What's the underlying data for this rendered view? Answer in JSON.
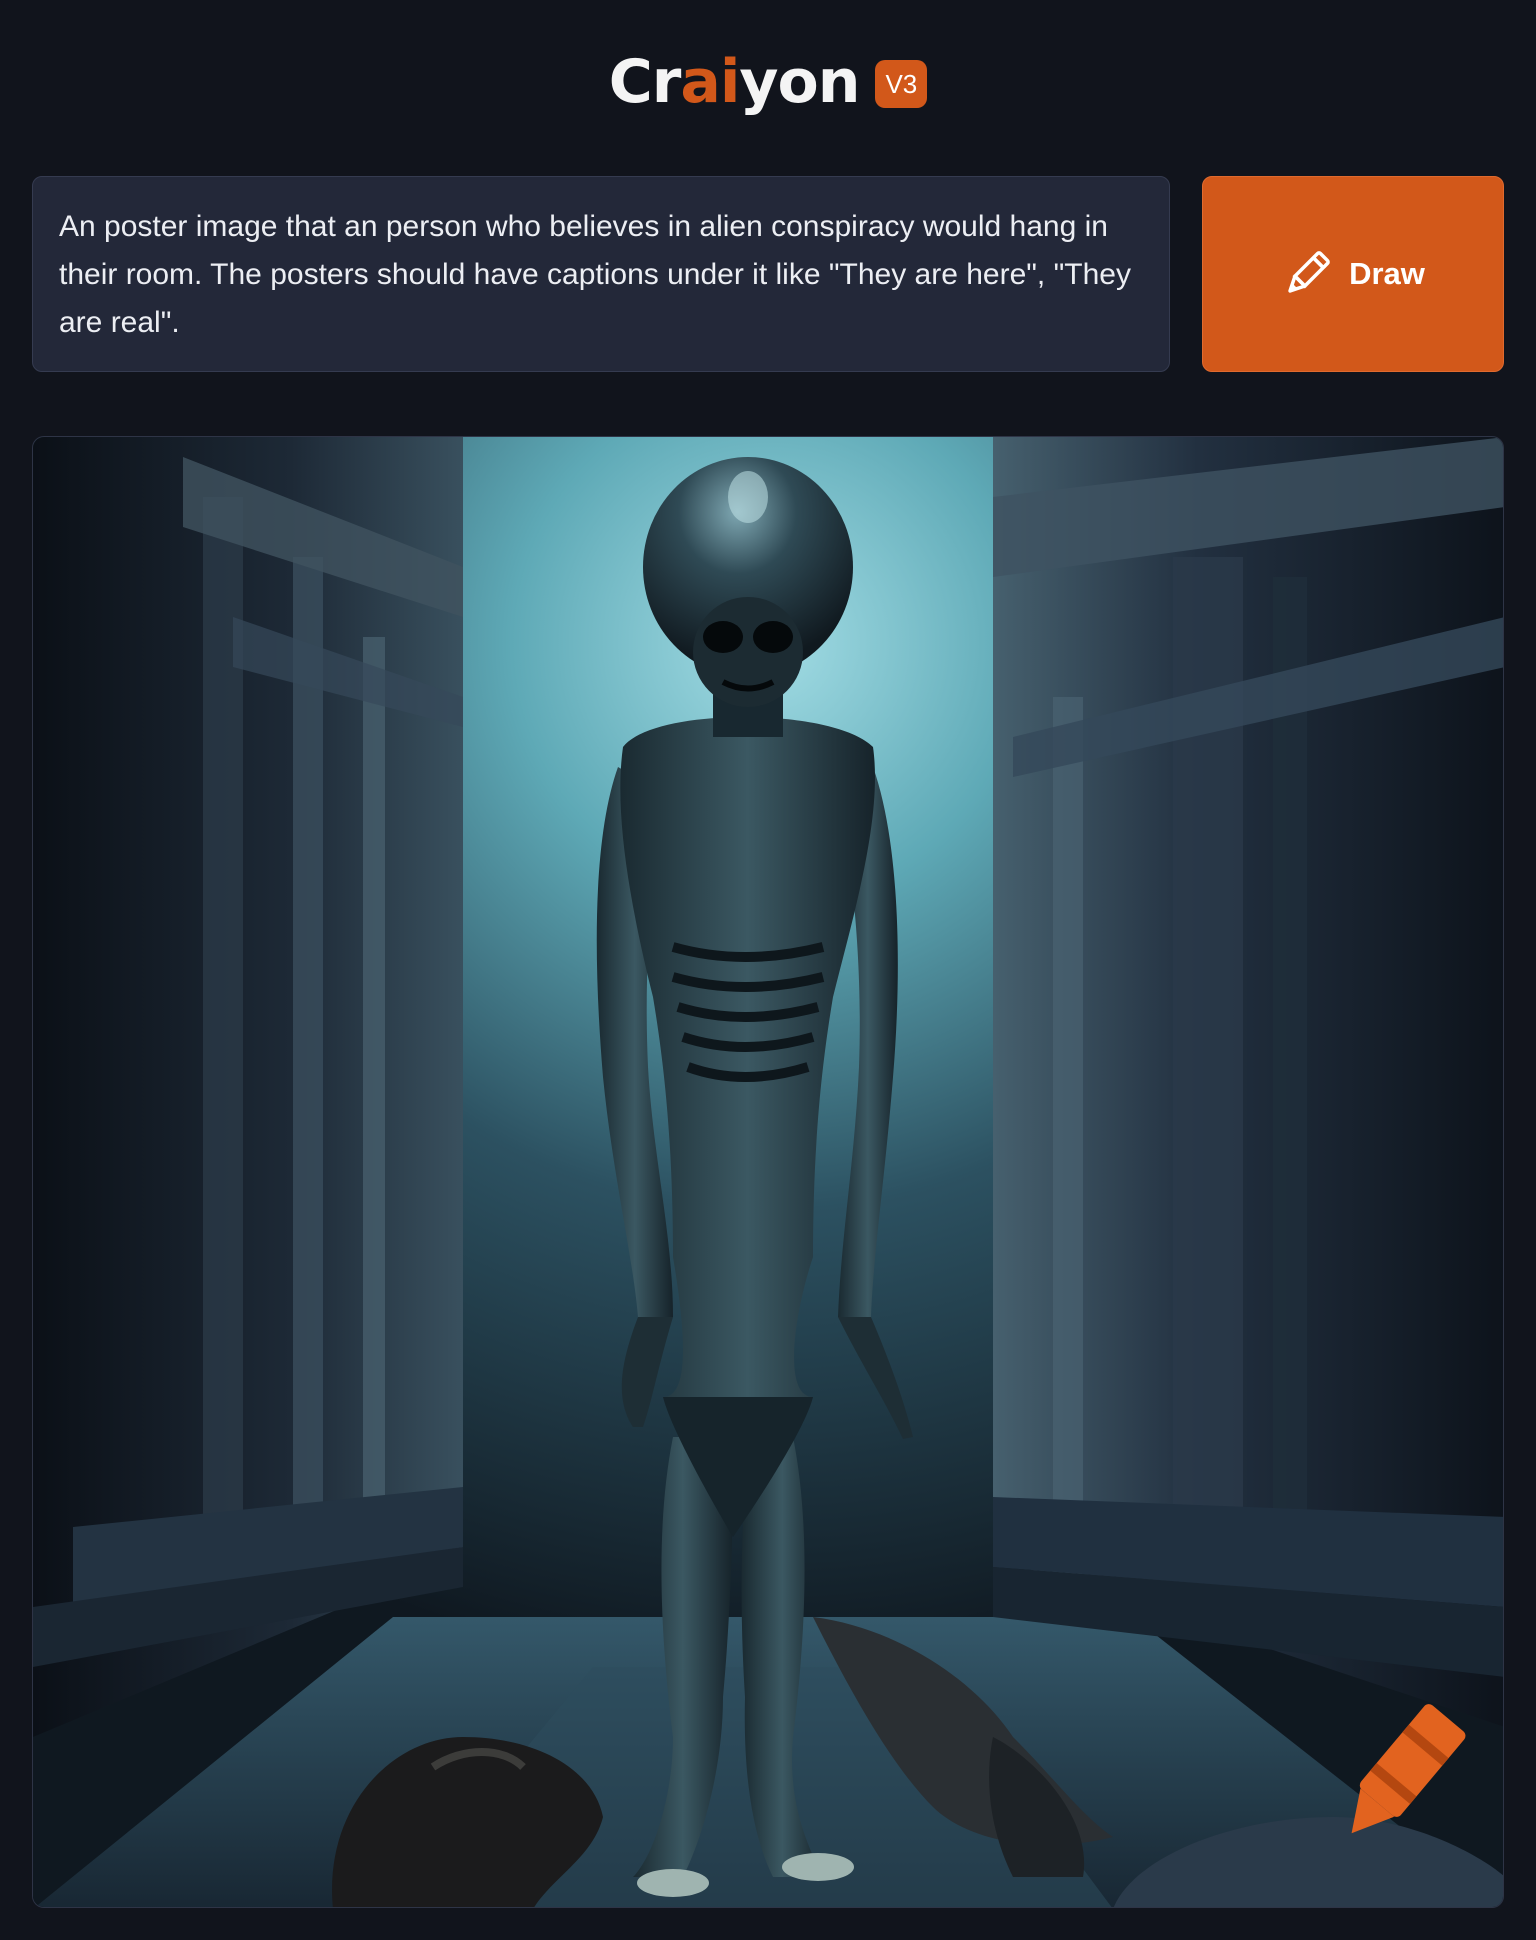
{
  "header": {
    "logo_part1": "Cr",
    "logo_part2": "ai",
    "logo_part3": "yon",
    "version_badge": "V3"
  },
  "prompt": {
    "text": "An poster image that an person who believes in alien conspiracy would hang in their room. The posters should have captions under it like \"They are here\", \"They are real\"."
  },
  "draw_button": {
    "label": "Draw",
    "icon": "pencil-icon"
  },
  "result": {
    "watermark_icon": "crayon-icon"
  },
  "colors": {
    "background": "#11141c",
    "accent": "#d2581a",
    "prompt_bg": "#232839"
  }
}
